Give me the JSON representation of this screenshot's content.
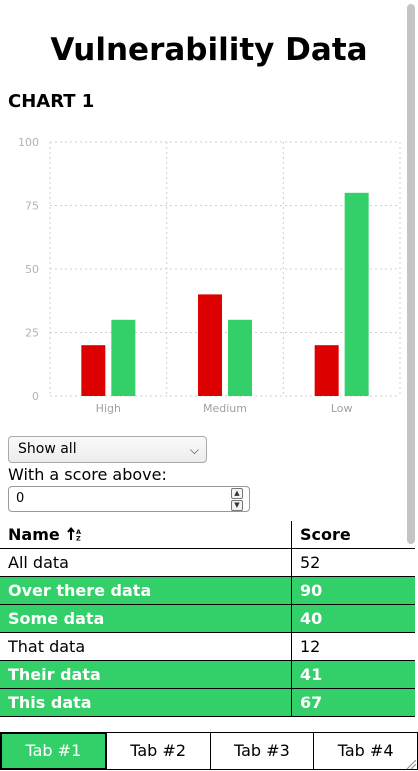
{
  "page": {
    "title": "Vulnerability Data"
  },
  "chart_heading": "CHART 1",
  "chart_data": {
    "type": "bar",
    "categories": [
      "High",
      "Medium",
      "Low"
    ],
    "series": [
      {
        "values": [
          20,
          40,
          20
        ],
        "color": "#dd0000"
      },
      {
        "values": [
          30,
          30,
          80
        ],
        "color": "#33d06a"
      }
    ],
    "ylim": [
      0,
      100
    ],
    "yticks": [
      "0",
      "25",
      "50",
      "75",
      "100"
    ],
    "grid": true
  },
  "filter": {
    "selected": "Show all"
  },
  "score_filter": {
    "label": "With a score above:",
    "value": "0"
  },
  "table": {
    "col_name": "Name",
    "col_score": "Score",
    "rows": [
      {
        "name": "All data",
        "score": "52",
        "highlight": false
      },
      {
        "name": "Over there data",
        "score": "90",
        "highlight": true
      },
      {
        "name": "Some data",
        "score": "40",
        "highlight": true
      },
      {
        "name": "That data",
        "score": "12",
        "highlight": false
      },
      {
        "name": "Their data",
        "score": "41",
        "highlight": true
      },
      {
        "name": "This data",
        "score": "67",
        "highlight": true
      }
    ]
  },
  "tabs": [
    "Tab #1",
    "Tab #2",
    "Tab #3",
    "Tab #4"
  ]
}
